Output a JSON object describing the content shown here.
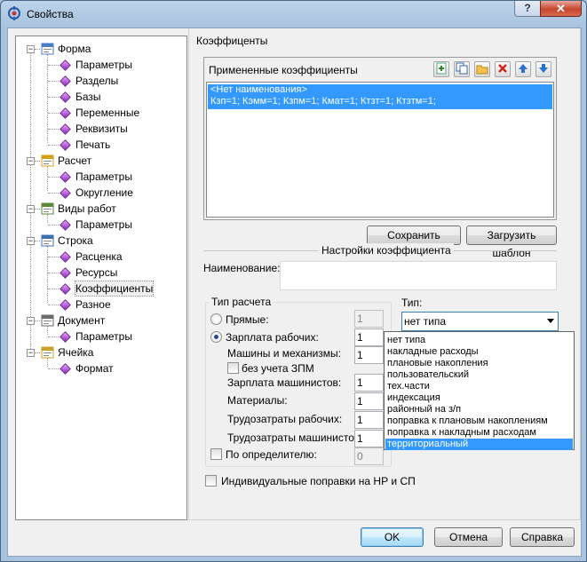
{
  "window": {
    "title": "Свойства",
    "help_label": "?",
    "close_label": "✕"
  },
  "tree": {
    "groups": [
      {
        "label": "Форма",
        "icon": "form-icon",
        "children": [
          "Параметры",
          "Разделы",
          "Базы",
          "Переменные",
          "Реквизиты",
          "Печать"
        ]
      },
      {
        "label": "Расчет",
        "icon": "calc-icon",
        "children": [
          "Параметры",
          "Округление"
        ]
      },
      {
        "label": "Виды работ",
        "icon": "worktypes-icon",
        "children": [
          "Параметры"
        ]
      },
      {
        "label": "Строка",
        "icon": "row-icon",
        "children": [
          "Расценка",
          "Ресурсы",
          "Коэффициенты",
          "Разное"
        ]
      },
      {
        "label": "Документ",
        "icon": "document-icon",
        "children": [
          "Параметры"
        ]
      },
      {
        "label": "Ячейка",
        "icon": "cell-icon",
        "children": [
          "Формат"
        ]
      }
    ]
  },
  "coeffs": {
    "section_title": "Коэффиценты",
    "applied_title": "Примененные коэффициенты",
    "applied_item_name": "<Нет наименования>",
    "applied_item_values": "Кзп=1; Кэмм=1; Кзпм=1; Кмат=1; Ктзт=1; Ктзтм=1;",
    "save_template": "Сохранить шаблон",
    "load_template": "Загрузить шаблон",
    "settings_title": "Настройки коэффициента",
    "name_label": "Наименование:",
    "name_value": ""
  },
  "calc_type": {
    "title": "Тип расчета",
    "direct_label": "Прямые:",
    "direct_value": "1",
    "wages_label": "Зарплата рабочих:",
    "wages_value": "1",
    "machines_label": "Машины и механизмы:",
    "machines_value": "1",
    "no_zpm_label": "без учета ЗПМ",
    "machinists_wages_label": "Зарплата машинистов:",
    "machinists_wages_value": "1",
    "materials_label": "Материалы:",
    "materials_value": "1",
    "labor_workers_label": "Трудозатраты рабочих:",
    "labor_workers_value": "1",
    "labor_machinists_label": "Трудозатраты машинистов:",
    "labor_machinists_value": "1",
    "by_determinant_label": "По определителю:",
    "by_determinant_value": "0"
  },
  "type": {
    "label": "Тип:",
    "selected": "нет типа",
    "options": [
      "нет типа",
      "накладные расходы",
      "плановые накопления",
      "пользовательский",
      "тех.части",
      "индексация",
      "районный на з/п",
      "поправка к плановым накоплениям",
      "поправка к накладным расходам",
      "территориальный"
    ],
    "highlighted_index": 9
  },
  "individual_label": "Индивидуальные поправки на НР и СП",
  "buttons": {
    "ok": "OK",
    "cancel": "Отмена",
    "help": "Справка"
  }
}
